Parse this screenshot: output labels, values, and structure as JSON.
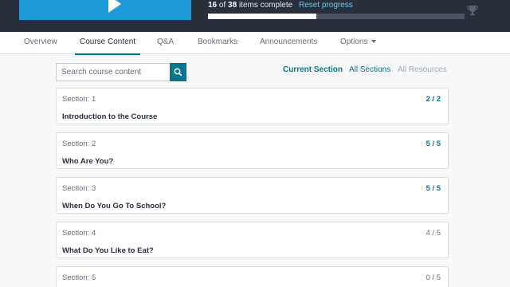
{
  "header": {
    "completed": "16",
    "of_word": "of",
    "total": "38",
    "suffix": "items complete",
    "progress_fraction": 0.421,
    "reset_label": "Reset progress",
    "trophy_icon": "trophy-icon",
    "play_icon": "play-icon"
  },
  "nav": {
    "tabs": [
      {
        "label": "Overview"
      },
      {
        "label": "Course Content"
      },
      {
        "label": "Q&A"
      },
      {
        "label": "Bookmarks"
      },
      {
        "label": "Announcements"
      },
      {
        "label": "Options"
      }
    ],
    "active_tab": "Course Content"
  },
  "search": {
    "placeholder": "Search course content",
    "icon": "search-icon"
  },
  "filters": {
    "current": "Current Section",
    "all_sections": "All Sections",
    "all_resources": "All Resources"
  },
  "sections": [
    {
      "label": "Section: 1",
      "count": "2 / 2",
      "title": "Introduction to the Course",
      "complete": true
    },
    {
      "label": "Section: 2",
      "count": "5 / 5",
      "title": "Who Are You?",
      "complete": true
    },
    {
      "label": "Section: 3",
      "count": "5 / 5",
      "title": "When Do You Go To School?",
      "complete": true
    },
    {
      "label": "Section: 4",
      "count": "4 / 5",
      "title": "What Do You Like to Eat?",
      "complete": false
    },
    {
      "label": "Section: 5",
      "count": "0 / 5",
      "title": "",
      "complete": false
    }
  ],
  "colors": {
    "header_bg": "#29303b",
    "accent": "#007791",
    "video_blue": "#1b9bd8"
  }
}
